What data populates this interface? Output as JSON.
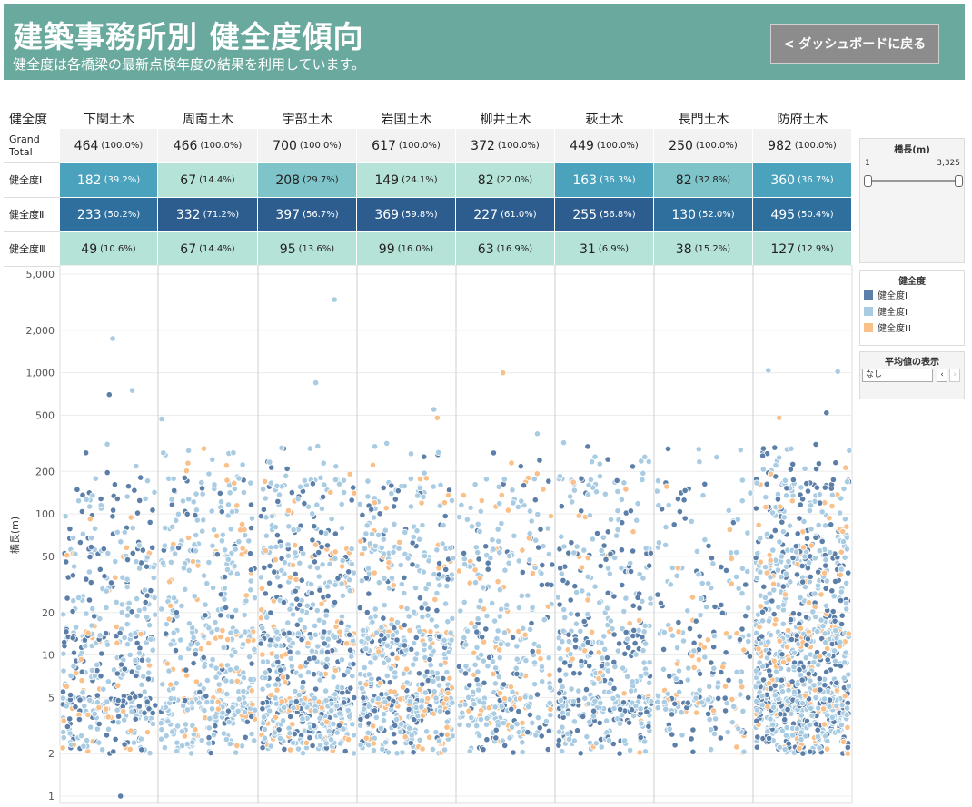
{
  "header": {
    "title": "建築事務所別 健全度傾向",
    "subtitle": "健全度は各橋梁の最新点検年度の結果を利用しています。",
    "back_button": "< ダッシュボードに戻る",
    "bg_color": "#6aa99e"
  },
  "table": {
    "corner_label": "健全度",
    "columns": [
      "下関土木",
      "周南土木",
      "宇部土木",
      "岩国土木",
      "柳井土木",
      "萩土木",
      "長門土木",
      "防府土木"
    ],
    "rows": [
      {
        "label": "Grand\nTotal",
        "cells": [
          {
            "v": "464",
            "p": "(100.0%)",
            "share": 1
          },
          {
            "v": "466",
            "p": "(100.0%)",
            "share": 1
          },
          {
            "v": "700",
            "p": "(100.0%)",
            "share": 1
          },
          {
            "v": "617",
            "p": "(100.0%)",
            "share": 1
          },
          {
            "v": "372",
            "p": "(100.0%)",
            "share": 1
          },
          {
            "v": "449",
            "p": "(100.0%)",
            "share": 1
          },
          {
            "v": "250",
            "p": "(100.0%)",
            "share": 1
          },
          {
            "v": "982",
            "p": "(100.0%)",
            "share": 1
          }
        ]
      },
      {
        "label": "健全度Ⅰ",
        "cells": [
          {
            "v": "182",
            "p": "(39.2%)",
            "share": 0.392
          },
          {
            "v": "67",
            "p": "(14.4%)",
            "share": 0.144
          },
          {
            "v": "208",
            "p": "(29.7%)",
            "share": 0.297
          },
          {
            "v": "149",
            "p": "(24.1%)",
            "share": 0.241
          },
          {
            "v": "82",
            "p": "(22.0%)",
            "share": 0.22
          },
          {
            "v": "163",
            "p": "(36.3%)",
            "share": 0.363
          },
          {
            "v": "82",
            "p": "(32.8%)",
            "share": 0.328
          },
          {
            "v": "360",
            "p": "(36.7%)",
            "share": 0.367
          }
        ]
      },
      {
        "label": "健全度Ⅱ",
        "cells": [
          {
            "v": "233",
            "p": "(50.2%)",
            "share": 0.502
          },
          {
            "v": "332",
            "p": "(71.2%)",
            "share": 0.712
          },
          {
            "v": "397",
            "p": "(56.7%)",
            "share": 0.567
          },
          {
            "v": "369",
            "p": "(59.8%)",
            "share": 0.598
          },
          {
            "v": "227",
            "p": "(61.0%)",
            "share": 0.61
          },
          {
            "v": "255",
            "p": "(56.8%)",
            "share": 0.568
          },
          {
            "v": "130",
            "p": "(52.0%)",
            "share": 0.52
          },
          {
            "v": "495",
            "p": "(50.4%)",
            "share": 0.504
          }
        ]
      },
      {
        "label": "健全度Ⅲ",
        "cells": [
          {
            "v": "49",
            "p": "(10.6%)",
            "share": 0.106
          },
          {
            "v": "67",
            "p": "(14.4%)",
            "share": 0.144
          },
          {
            "v": "95",
            "p": "(13.6%)",
            "share": 0.136
          },
          {
            "v": "99",
            "p": "(16.0%)",
            "share": 0.16
          },
          {
            "v": "63",
            "p": "(16.9%)",
            "share": 0.169
          },
          {
            "v": "31",
            "p": "(6.9%)",
            "share": 0.069
          },
          {
            "v": "38",
            "p": "(15.2%)",
            "share": 0.152
          },
          {
            "v": "127",
            "p": "(12.9%)",
            "share": 0.129
          }
        ]
      }
    ]
  },
  "filter": {
    "title": "橋長(m)",
    "min_label": "1",
    "max_label": "3,325"
  },
  "legend": {
    "title": "健全度",
    "items": [
      {
        "label": "健全度Ⅰ",
        "color": "#5b7fa8"
      },
      {
        "label": "健全度Ⅱ",
        "color": "#a9cce3"
      },
      {
        "label": "健全度Ⅲ",
        "color": "#f9c08a"
      }
    ]
  },
  "average": {
    "title": "平均値の表示",
    "value": "なし"
  },
  "chart_data": {
    "type": "scatter",
    "ylabel": "橋長(m)",
    "yscale": "log",
    "ylim": [
      1,
      5000
    ],
    "y_ticks": [
      {
        "value": 1,
        "label": "1"
      },
      {
        "value": 2,
        "label": "2"
      },
      {
        "value": 5,
        "label": "5"
      },
      {
        "value": 10,
        "label": "10"
      },
      {
        "value": 20,
        "label": "20"
      },
      {
        "value": 50,
        "label": "50"
      },
      {
        "value": 100,
        "label": "100"
      },
      {
        "value": 200,
        "label": "200"
      },
      {
        "value": 500,
        "label": "500"
      },
      {
        "value": 1000,
        "label": "1,000"
      },
      {
        "value": 2000,
        "label": "2,000"
      },
      {
        "value": 5000,
        "label": "5,000"
      }
    ],
    "categories": [
      "下関土木",
      "周南土木",
      "宇部土木",
      "岩国土木",
      "柳井土木",
      "萩土木",
      "長門土木",
      "防府土木"
    ],
    "series_colors": {
      "I": "#5b7fa8",
      "II": "#a9cce3",
      "III": "#f9c08a"
    },
    "counts": {
      "I": [
        182,
        67,
        208,
        149,
        82,
        163,
        82,
        360
      ],
      "II": [
        233,
        332,
        397,
        369,
        227,
        255,
        130,
        495
      ],
      "III": [
        49,
        67,
        95,
        99,
        63,
        31,
        38,
        127
      ]
    },
    "notable_points": [
      {
        "office": "下関土木",
        "level": "I",
        "y": 1
      },
      {
        "office": "下関土木",
        "level": "II",
        "y": 1750
      },
      {
        "office": "下関土木",
        "level": "I",
        "y": 700
      },
      {
        "office": "下関土木",
        "level": "II",
        "y": 750
      },
      {
        "office": "周南土木",
        "level": "II",
        "y": 470
      },
      {
        "office": "宇部土木",
        "level": "II",
        "y": 3300
      },
      {
        "office": "宇部土木",
        "level": "II",
        "y": 850
      },
      {
        "office": "岩国土木",
        "level": "II",
        "y": 550
      },
      {
        "office": "岩国土木",
        "level": "III",
        "y": 480
      },
      {
        "office": "柳井土木",
        "level": "III",
        "y": 1000
      },
      {
        "office": "柳井土木",
        "level": "II",
        "y": 370
      },
      {
        "office": "萩土木",
        "level": "I",
        "y": 300
      },
      {
        "office": "防府土木",
        "level": "II",
        "y": 1020
      },
      {
        "office": "防府土木",
        "level": "II",
        "y": 1040
      },
      {
        "office": "防府土木",
        "level": "I",
        "y": 520
      },
      {
        "office": "防府土木",
        "level": "III",
        "y": 480
      }
    ]
  }
}
